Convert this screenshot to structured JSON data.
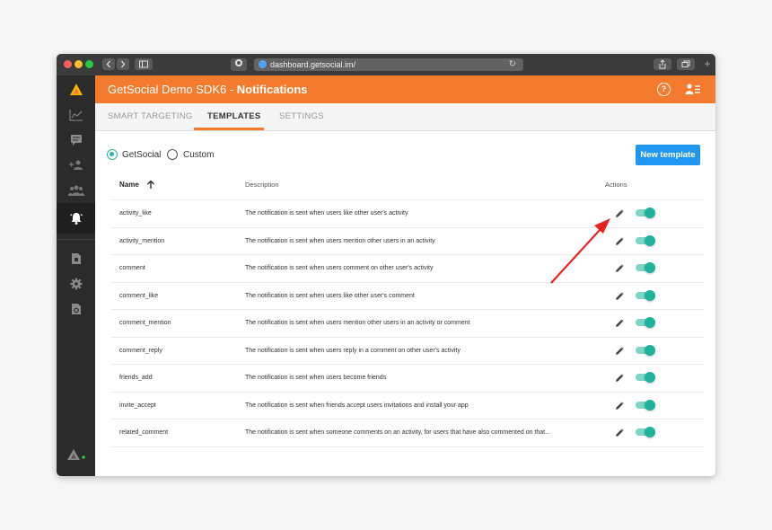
{
  "browser": {
    "url": "dashboard.getsocial.im/"
  },
  "header": {
    "app_name": "GetSocial Demo SDK6 - ",
    "page_name": "Notifications",
    "help_label": "?"
  },
  "tabs": [
    {
      "label": "SMART TARGETING",
      "active": false
    },
    {
      "label": "TEMPLATES",
      "active": true
    },
    {
      "label": "SETTINGS",
      "active": false
    }
  ],
  "filter": {
    "options": [
      {
        "label": "GetSocial",
        "selected": true
      },
      {
        "label": "Custom",
        "selected": false
      }
    ]
  },
  "new_template_label": "New template",
  "table": {
    "columns": {
      "name": "Name",
      "description": "Description",
      "actions": "Actions"
    },
    "rows": [
      {
        "name": "activity_like",
        "description": "The notification is sent when users like other user's activity",
        "enabled": true
      },
      {
        "name": "activity_mention",
        "description": "The notification is sent when users mention other users in an activity",
        "enabled": true
      },
      {
        "name": "comment",
        "description": "The notification is sent when users comment on other user's activity",
        "enabled": true
      },
      {
        "name": "comment_like",
        "description": "The notification is sent when users like other user's comment",
        "enabled": true
      },
      {
        "name": "comment_mention",
        "description": "The notification is sent when users mention other users in an activity or comment",
        "enabled": true
      },
      {
        "name": "comment_reply",
        "description": "The notification is sent when users reply in a comment on other user's activity",
        "enabled": true
      },
      {
        "name": "friends_add",
        "description": "The notification is sent when users become friends",
        "enabled": true
      },
      {
        "name": "invite_accept",
        "description": "The notification is sent when friends accept users invitations and install your app",
        "enabled": true
      },
      {
        "name": "related_comment",
        "description": "The notification is sent when someone comments on an activity, for users that have also commented on that...",
        "enabled": true
      }
    ]
  },
  "colors": {
    "brand": "#f47b2e",
    "accent": "#2196f3",
    "toggle_on": "#20b39c",
    "annotation_arrow": "#e8231f"
  },
  "icons": {
    "sidebar": [
      "logo-icon",
      "analytics-icon",
      "activity-feed-icon",
      "users-icon",
      "groups-icon",
      "notifications-icon",
      "documents-icon",
      "settings-icon",
      "export-icon",
      "footer-logo-icon"
    ]
  }
}
